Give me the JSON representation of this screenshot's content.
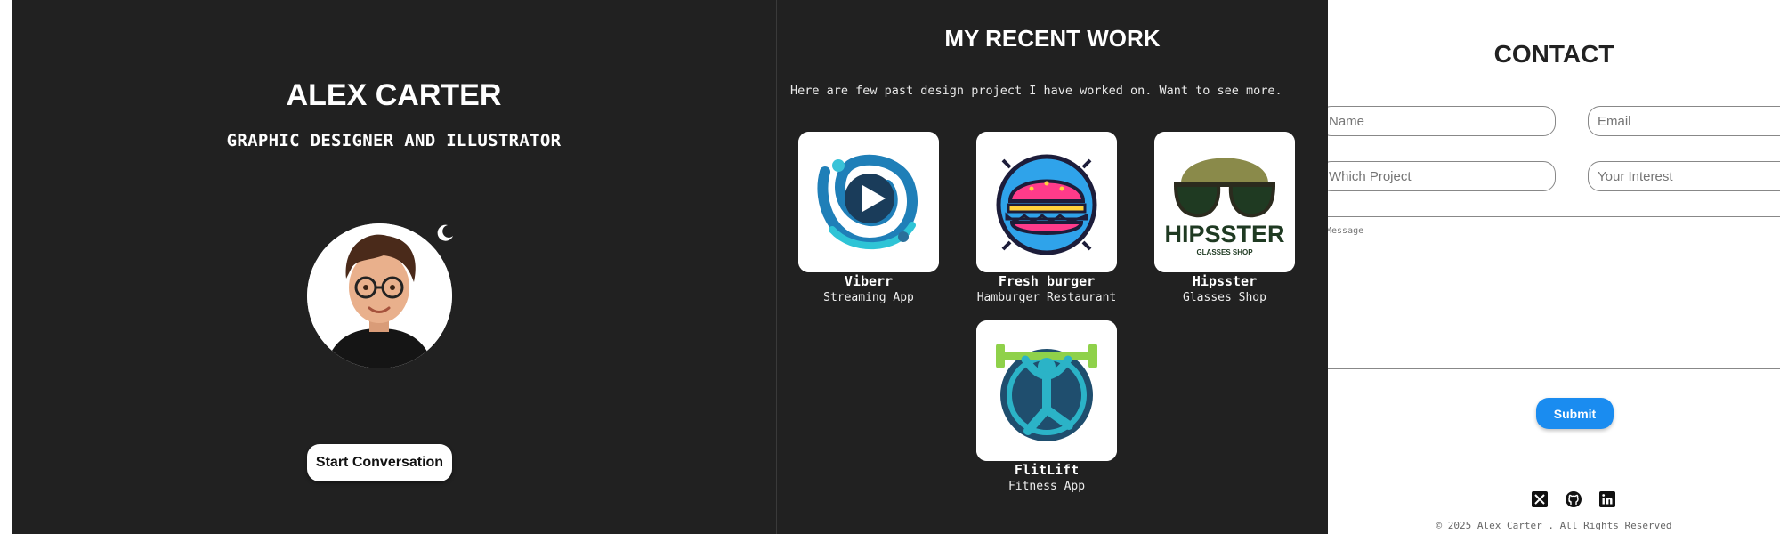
{
  "hero": {
    "name": "ALEX CARTER",
    "role": "GRAPHIC DESIGNER AND ILLUSTRATOR",
    "cta_label": "Start Conversation",
    "theme_icon": "moon-icon"
  },
  "work": {
    "title": "MY RECENT WORK",
    "intro": "Here are few past design project I have worked on. Want to see more.",
    "projects": [
      {
        "name": "Viberr",
        "desc": "Streaming App"
      },
      {
        "name": "Fresh burger",
        "desc": "Hamburger Restaurant"
      },
      {
        "name": "Hipsster",
        "desc": "Glasses Shop",
        "logo_text": "HIPSSTER",
        "logo_subtext": "GLASSES SHOP"
      },
      {
        "name": "FlitLift",
        "desc": "Fitness App"
      }
    ]
  },
  "contact": {
    "title": "CONTACT",
    "name_placeholder": "Name",
    "email_placeholder": "Email",
    "project_placeholder": "Which Project",
    "interest_placeholder": "Your Interest",
    "message_placeholder": "Message",
    "submit_label": "Submit",
    "accent_color": "#1a8cf0",
    "social": [
      "x-icon",
      "github-icon",
      "linkedin-icon"
    ],
    "copyright": "© 2025 Alex Carter . All Rights Reserved"
  }
}
